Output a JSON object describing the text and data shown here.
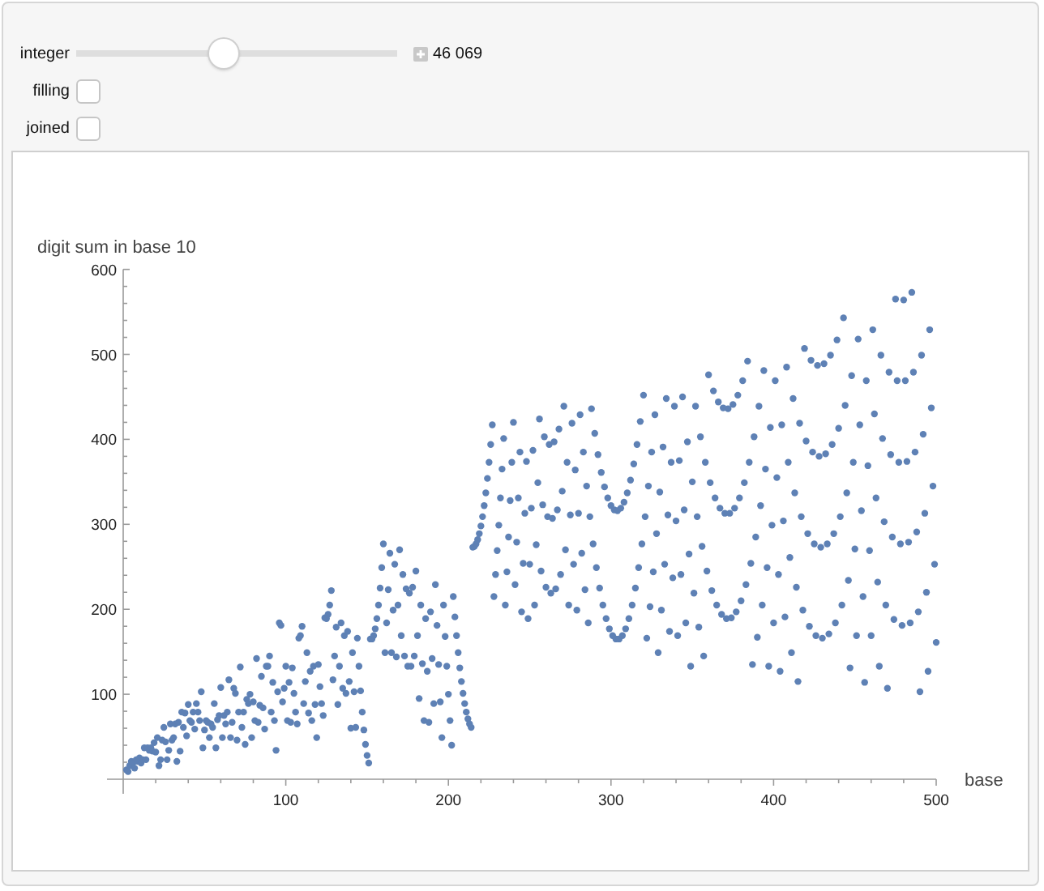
{
  "slider": {
    "label": "integer",
    "level": 0.46,
    "value": "46 069"
  },
  "checkboxes": [
    {
      "label": "filling",
      "checked": false
    },
    {
      "label": "joined",
      "checked": false
    }
  ],
  "plot": {
    "chart_data": {
      "type": "scatter",
      "xlabel": "base",
      "ylabel": "digit sum in base 10",
      "xlim": [
        0,
        500
      ],
      "ylim": [
        0,
        600
      ],
      "xticks": [
        100,
        200,
        300,
        400,
        500
      ],
      "yticks": [
        100,
        200,
        300,
        400,
        500,
        600
      ],
      "x": [
        2,
        3,
        4,
        5,
        6,
        7,
        8,
        9,
        10,
        11,
        12,
        13,
        14,
        15,
        16,
        17,
        18,
        19,
        20,
        21,
        22,
        23,
        24,
        25,
        26,
        27,
        28,
        29,
        30,
        31,
        32,
        33,
        34,
        35,
        36,
        37,
        38,
        39,
        40,
        41,
        42,
        43,
        44,
        45,
        46,
        47,
        48,
        49,
        50,
        51,
        52,
        53,
        54,
        55,
        56,
        57,
        58,
        59,
        60,
        61,
        62,
        63,
        64,
        65,
        66,
        67,
        68,
        69,
        70,
        71,
        72,
        73,
        74,
        75,
        76,
        77,
        78,
        79,
        80,
        81,
        82,
        83,
        84,
        85,
        86,
        87,
        88,
        89,
        90,
        91,
        92,
        93,
        94,
        95,
        96,
        97,
        98,
        99,
        100,
        101,
        102,
        103,
        104,
        105,
        106,
        107,
        108,
        109,
        110,
        111,
        112,
        113,
        114,
        115,
        116,
        117,
        118,
        119,
        120,
        121,
        122,
        123,
        124,
        125,
        126,
        127,
        128,
        129,
        130,
        131,
        132,
        133,
        134,
        135,
        136,
        137,
        138,
        139,
        140,
        141,
        142,
        143,
        144,
        145,
        146,
        147,
        148,
        149,
        150,
        151,
        152,
        153,
        154,
        155,
        156,
        157,
        158,
        159,
        160,
        161,
        162,
        163,
        164,
        165,
        166,
        167,
        168,
        169,
        170,
        171,
        172,
        173,
        174,
        175,
        176,
        177,
        178,
        179,
        180,
        181,
        182,
        183,
        184,
        185,
        186,
        187,
        188,
        189,
        190,
        191,
        192,
        193,
        194,
        195,
        196,
        197,
        198,
        199,
        200,
        201,
        202,
        203,
        204,
        205,
        206,
        207,
        208,
        209,
        210,
        211,
        212,
        213,
        214,
        215,
        216,
        217,
        218,
        219,
        220,
        221,
        222,
        223,
        224,
        225,
        226,
        227,
        228,
        229,
        230,
        231,
        232,
        233,
        234,
        235,
        236,
        237,
        238,
        239,
        240,
        241,
        242,
        243,
        244,
        245,
        246,
        247,
        248,
        249,
        250,
        251,
        252,
        253,
        254,
        255,
        256,
        257,
        258,
        259,
        260,
        261,
        262,
        263,
        264,
        265,
        266,
        267,
        268,
        269,
        270,
        271,
        272,
        273,
        274,
        275,
        276,
        277,
        278,
        279,
        280,
        281,
        282,
        283,
        284,
        285,
        286,
        287,
        288,
        289,
        290,
        291,
        292,
        293,
        294,
        295,
        296,
        297,
        298,
        299,
        300,
        301,
        302,
        303,
        304,
        305,
        306,
        307,
        308,
        309,
        310,
        311,
        312,
        313,
        314,
        315,
        316,
        317,
        318,
        319,
        320,
        321,
        322,
        323,
        324,
        325,
        326,
        327,
        328,
        329,
        330,
        331,
        332,
        333,
        334,
        335,
        336,
        337,
        338,
        339,
        340,
        341,
        342,
        343,
        344,
        345,
        346,
        347,
        348,
        349,
        350,
        351,
        352,
        353,
        354,
        355,
        356,
        357,
        358,
        359,
        360,
        361,
        362,
        363,
        364,
        365,
        366,
        367,
        368,
        369,
        370,
        371,
        372,
        373,
        374,
        375,
        376,
        377,
        378,
        379,
        380,
        381,
        382,
        383,
        384,
        385,
        386,
        387,
        388,
        389,
        390,
        391,
        392,
        393,
        394,
        395,
        396,
        397,
        398,
        399,
        400,
        401,
        402,
        403,
        404,
        405,
        406,
        407,
        408,
        409,
        410,
        411,
        412,
        413,
        414,
        415,
        416,
        417,
        418,
        419,
        420,
        421,
        422,
        423,
        424,
        425,
        426,
        427,
        428,
        429,
        430,
        431,
        432,
        433,
        434,
        435,
        436,
        437,
        438,
        439,
        440,
        441,
        442,
        443,
        444,
        445,
        446,
        447,
        448,
        449,
        450,
        451,
        452,
        453,
        454,
        455,
        456,
        457,
        458,
        459,
        460,
        461,
        462,
        463,
        464,
        465,
        466,
        467,
        468,
        469,
        470,
        471,
        472,
        473,
        474,
        475,
        476,
        477,
        478,
        479,
        480,
        481,
        482,
        483,
        484,
        485,
        486,
        487,
        488,
        489,
        490,
        491,
        492,
        493,
        494,
        495,
        496,
        497,
        498,
        499,
        500
      ],
      "series": [
        {
          "color": "#5e81b5",
          "values": [
            11,
            9,
            16,
            21,
            19,
            13,
            23,
            21,
            25,
            19,
            23,
            37,
            23,
            37,
            34,
            37,
            33,
            43,
            32,
            49,
            16,
            23,
            46,
            61,
            44,
            23,
            34,
            65,
            46,
            49,
            65,
            21,
            67,
            33,
            79,
            61,
            78,
            51,
            88,
            69,
            67,
            79,
            59,
            89,
            79,
            69,
            103,
            37,
            58,
            69,
            67,
            49,
            65,
            61,
            89,
            37,
            70,
            75,
            108,
            49,
            75,
            65,
            79,
            117,
            49,
            67,
            107,
            101,
            46,
            79,
            132,
            61,
            79,
            41,
            94,
            89,
            100,
            49,
            91,
            69,
            142,
            67,
            87,
            121,
            84,
            59,
            133,
            133,
            145,
            79,
            114,
            69,
            34,
            103,
            184,
            181,
            91,
            107,
            133,
            69,
            114,
            67,
            131,
            101,
            79,
            65,
            166,
            169,
            180,
            89,
            115,
            149,
            78,
            127,
            69,
            133,
            88,
            49,
            135,
            109,
            89,
            75,
            190,
            189,
            194,
            205,
            222,
            117,
            145,
            179,
            88,
            133,
            184,
            107,
            169,
            101,
            174,
            115,
            60,
            149,
            103,
            61,
            166,
            133,
            104,
            79,
            58,
            41,
            28,
            19,
            165,
            165,
            169,
            177,
            189,
            205,
            225,
            249,
            277,
            149,
            184,
            223,
            266,
            149,
            199,
            253,
            144,
            205,
            270,
            169,
            241,
            145,
            224,
            133,
            219,
            133,
            226,
            145,
            245,
            169,
            95,
            205,
            136,
            69,
            189,
            127,
            67,
            197,
            142,
            89,
            229,
            181,
            135,
            91,
            49,
            205,
            168,
            133,
            100,
            69,
            40,
            215,
            191,
            169,
            149,
            131,
            115,
            101,
            89,
            79,
            71,
            65,
            61,
            273,
            274,
            277,
            282,
            289,
            298,
            309,
            322,
            337,
            354,
            373,
            394,
            417,
            215,
            241,
            269,
            299,
            331,
            365,
            401,
            205,
            244,
            285,
            328,
            373,
            420,
            229,
            279,
            331,
            385,
            197,
            254,
            313,
            374,
            189,
            253,
            319,
            387,
            205,
            276,
            349,
            424,
            245,
            323,
            403,
            226,
            309,
            394,
            219,
            307,
            397,
            224,
            317,
            412,
            241,
            339,
            439,
            270,
            373,
            205,
            311,
            419,
            253,
            364,
            199,
            313,
            429,
            266,
            385,
            223,
            345,
            184,
            309,
            436,
            277,
            407,
            249,
            382,
            225,
            361,
            205,
            344,
            189,
            331,
            177,
            322,
            169,
            317,
            165,
            316,
            165,
            319,
            169,
            326,
            177,
            337,
            189,
            352,
            205,
            371,
            225,
            394,
            249,
            421,
            277,
            452,
            309,
            166,
            345,
            203,
            385,
            244,
            429,
            289,
            149,
            338,
            199,
            391,
            253,
            448,
            311,
            174,
            373,
            237,
            439,
            304,
            169,
            375,
            241,
            450,
            317,
            184,
            397,
            265,
            133,
            350,
            219,
            439,
            309,
            179,
            403,
            274,
            145,
            373,
            245,
            476,
            349,
            222,
            457,
            331,
            205,
            444,
            319,
            194,
            437,
            313,
            189,
            436,
            313,
            190,
            441,
            319,
            197,
            452,
            331,
            210,
            469,
            349,
            229,
            492,
            373,
            254,
            135,
            403,
            285,
            167,
            439,
            322,
            205,
            481,
            365,
            249,
            133,
            414,
            299,
            184,
            469,
            355,
            241,
            127,
            417,
            304,
            191,
            485,
            373,
            261,
            149,
            448,
            337,
            226,
            115,
            419,
            309,
            199,
            507,
            398,
            289,
            180,
            493,
            385,
            277,
            169,
            487,
            380,
            273,
            166,
            489,
            383,
            277,
            171,
            499,
            394,
            289,
            184,
            517,
            413,
            309,
            205,
            543,
            440,
            337,
            234,
            131,
            475,
            373,
            271,
            169,
            518,
            417,
            316,
            215,
            114,
            469,
            369,
            269,
            169,
            529,
            430,
            331,
            232,
            133,
            499,
            401,
            303,
            205,
            107,
            479,
            382,
            285,
            188,
            565,
            469,
            373,
            277,
            181,
            564,
            469,
            374,
            279,
            184,
            573,
            479,
            385,
            291,
            197,
            103,
            499,
            406,
            313,
            220,
            127,
            529,
            437,
            345,
            253,
            161
          ]
        }
      ]
    }
  }
}
